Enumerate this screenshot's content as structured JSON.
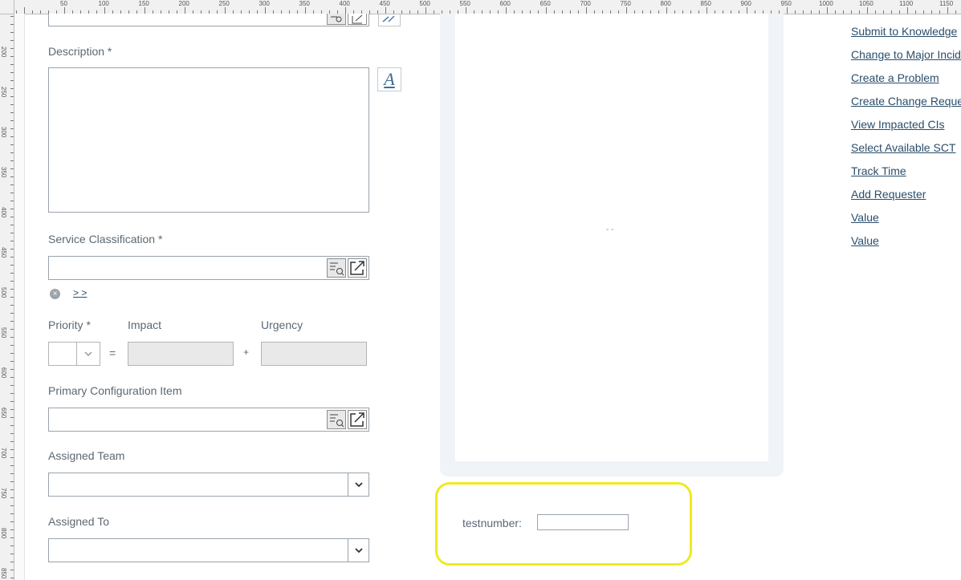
{
  "ruler": {
    "top_labels": [
      "50",
      "100",
      "150",
      "200",
      "250",
      "300",
      "350",
      "400",
      "450",
      "500",
      "550",
      "600",
      "650",
      "700",
      "750",
      "800",
      "850",
      "900",
      "950",
      "1000",
      "1050",
      "1100",
      "1150"
    ],
    "left_labels": [
      "200",
      "250",
      "300",
      "350",
      "400",
      "450",
      "500",
      "550",
      "600",
      "650",
      "700",
      "750",
      "800",
      "850"
    ]
  },
  "form": {
    "description_label": "Description *",
    "service_classification_label": "Service Classification *",
    "priority_label": "Priority *",
    "impact_label": "Impact",
    "urgency_label": "Urgency",
    "equals_symbol": "=",
    "plus_symbol": "+",
    "primary_ci_label": "Primary Configuration Item",
    "assigned_team_label": "Assigned Team",
    "assigned_to_label": "Assigned To",
    "expand_link": "> >",
    "description_value": "",
    "service_classification_value": "",
    "priority_value": "",
    "impact_value": "",
    "urgency_value": "",
    "primary_ci_value": "",
    "assigned_team_value": "",
    "assigned_to_value": ""
  },
  "panel": {
    "placeholder_text": "- -"
  },
  "highlight": {
    "testnumber_label": "testnumber:",
    "testnumber_value": ""
  },
  "actions": [
    "Submit to Knowledge",
    "Change to Major Incid",
    "Create a Problem",
    "Create Change Reques",
    "View Impacted CIs",
    "Select Available SCT",
    "Track Time",
    "Add Requester",
    "Value",
    "Value"
  ],
  "colors": {
    "link": "#2a4e6b",
    "highlight_border": "#f0ea1e",
    "panel_background": "#f0f3f7"
  }
}
